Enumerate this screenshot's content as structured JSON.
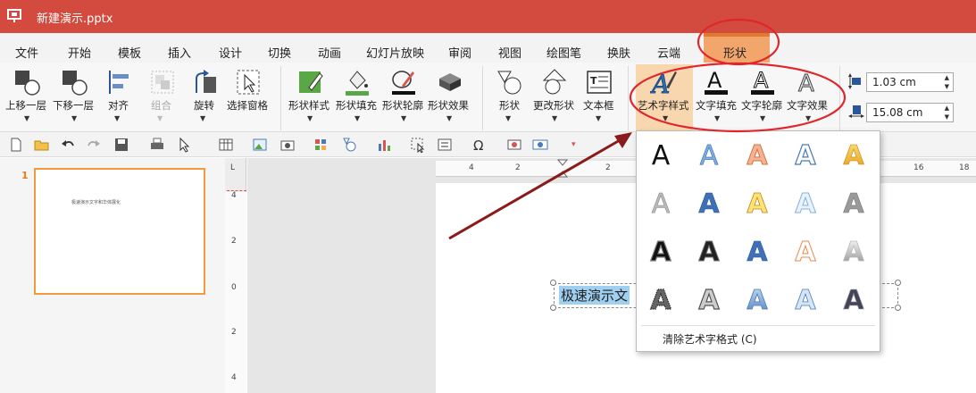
{
  "window": {
    "title": "新建演示.pptx"
  },
  "menu": {
    "tabs": [
      "文件",
      "开始",
      "模板",
      "插入",
      "设计",
      "切换",
      "动画",
      "幻灯片放映",
      "审阅",
      "视图",
      "绘图笔",
      "换肤",
      "云端"
    ],
    "active_tab": "形状"
  },
  "ribbon": {
    "bring_forward": "上移一层",
    "send_backward": "下移一层",
    "align": "对齐",
    "group": "组合",
    "rotate": "旋转",
    "selection_pane": "选择窗格",
    "shape_style": "形状样式",
    "shape_fill": "形状填充",
    "shape_outline": "形状轮廓",
    "shape_effect": "形状效果",
    "shape": "形状",
    "change_shape": "更改形状",
    "text_box": "文本框",
    "art_style": "艺术字样式",
    "text_fill": "文字填充",
    "text_outline": "文字轮廓",
    "text_effect": "文字效果",
    "height_value": "1.03 cm",
    "width_value": "15.08 cm"
  },
  "slides": {
    "number": "1",
    "thumb_text": "极速演示文字和华体展化"
  },
  "vruler_labels": [
    "4",
    "2",
    "0",
    "2",
    "4"
  ],
  "hruler_labels": [
    "4",
    "2",
    "2",
    "16",
    "18"
  ],
  "ruler_corner": "L",
  "slide_text": "极速演示文",
  "gallery": {
    "sample": "A",
    "clear_label": "清除艺术字格式 (C)"
  },
  "colors": {
    "titlebar": "#d24b3e",
    "active_tab": "#f2a66b",
    "annotation": "#e0262b",
    "arrow": "#8b1a1a"
  }
}
